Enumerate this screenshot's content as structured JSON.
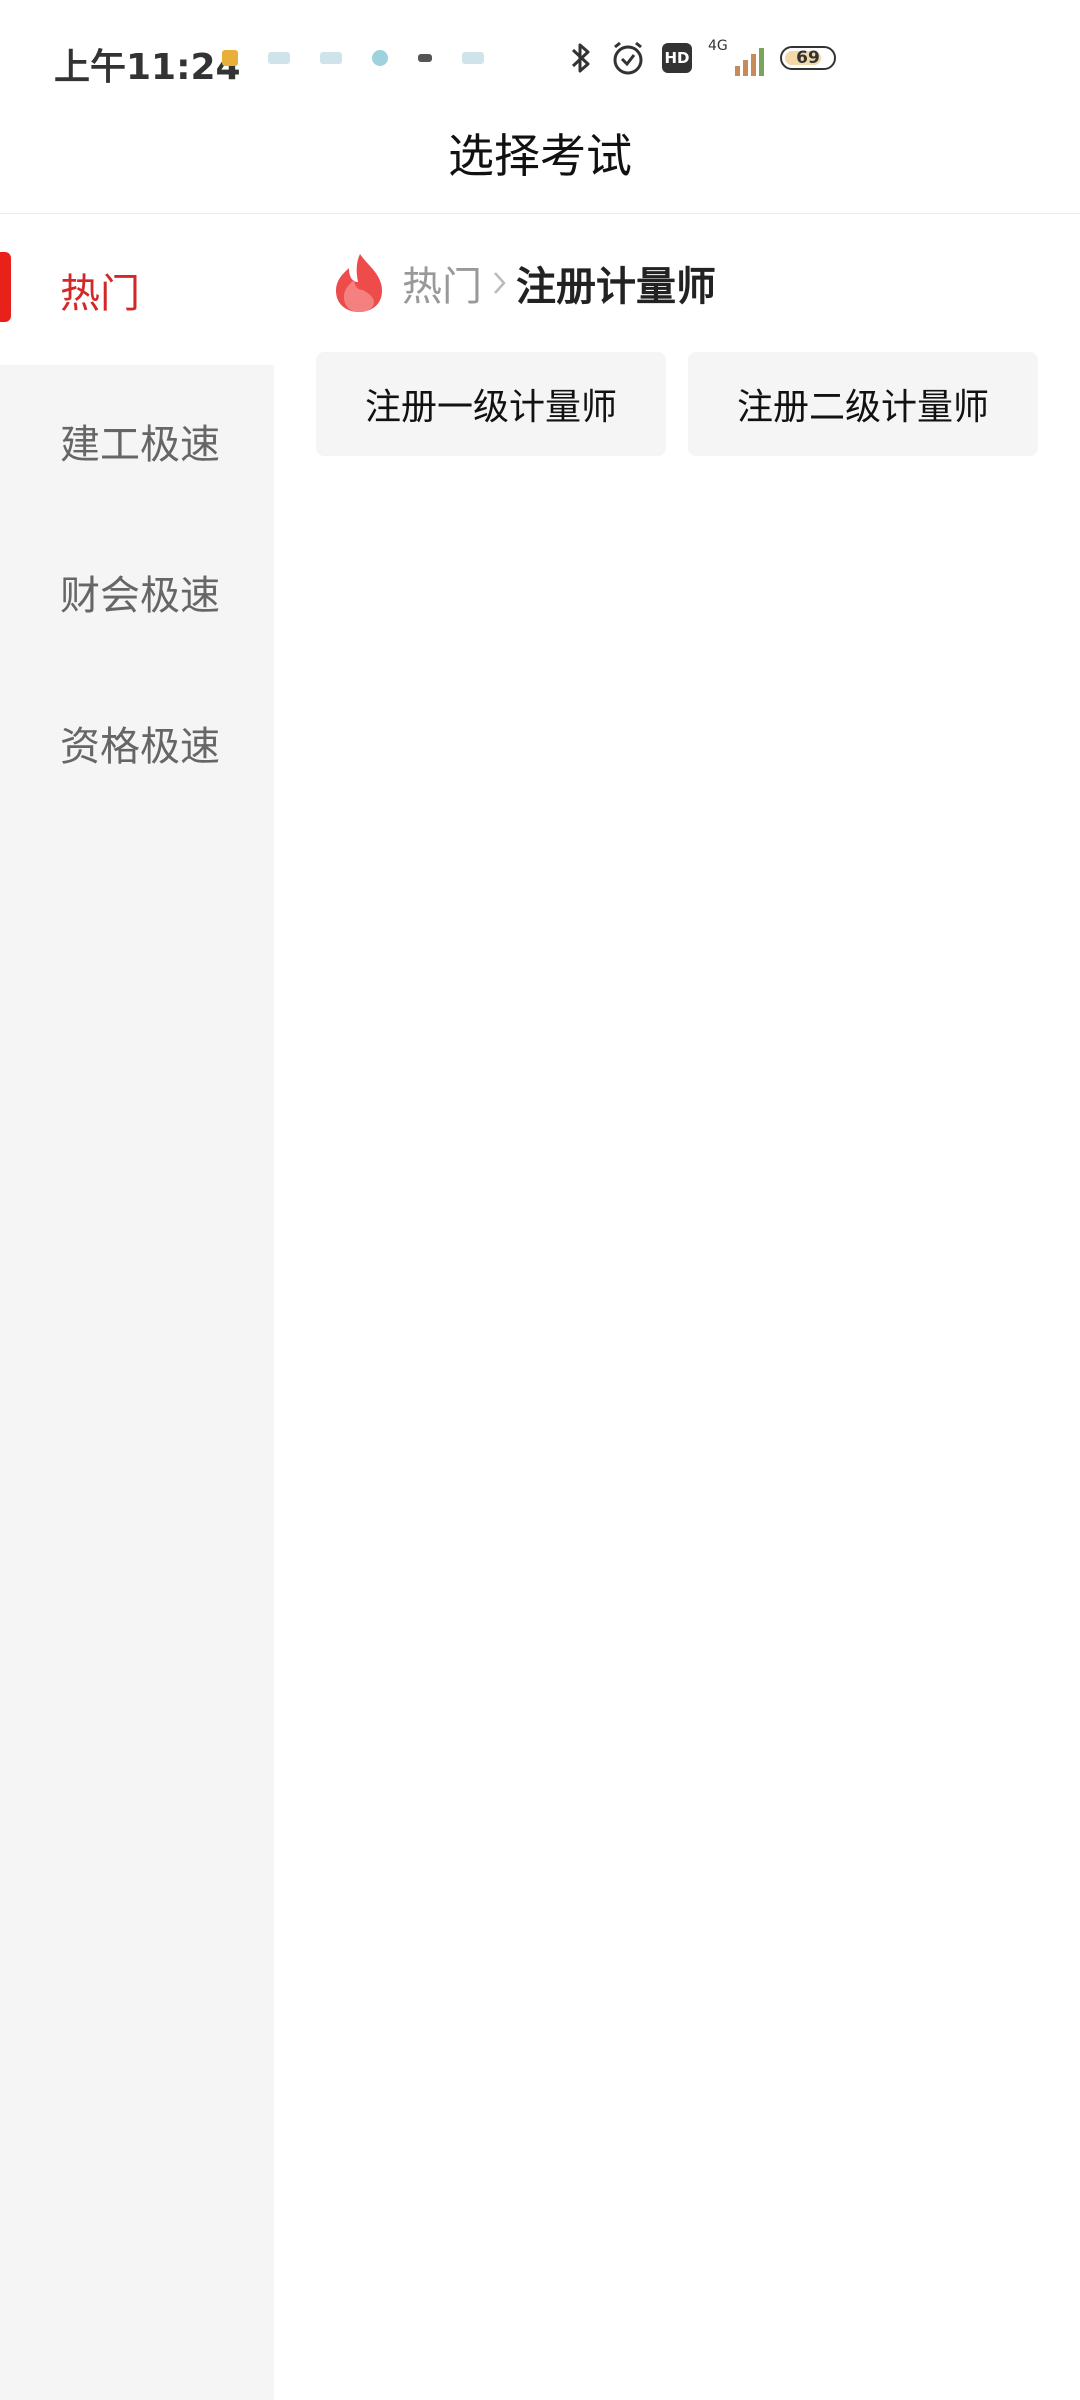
{
  "status_bar": {
    "time": "上午11:24",
    "network": "4G",
    "battery": "69",
    "icons": [
      "bluetooth-icon",
      "alarm-icon",
      "hd-icon",
      "signal-icon",
      "battery-icon"
    ]
  },
  "header": {
    "title": "选择考试"
  },
  "sidebar": {
    "items": [
      {
        "label": "热门",
        "active": true
      },
      {
        "label": "建工极速",
        "active": false
      },
      {
        "label": "财会极速",
        "active": false
      },
      {
        "label": "资格极速",
        "active": false
      }
    ]
  },
  "main": {
    "breadcrumb": {
      "parent": "热门",
      "current": "注册计量师"
    },
    "exams": [
      {
        "label": "注册一级计量师"
      },
      {
        "label": "注册二级计量师"
      }
    ]
  },
  "colors": {
    "accent": "#e8221b",
    "active_text": "#d22828",
    "sidebar_bg": "#f5f5f5",
    "button_bg": "#f5f5f5"
  }
}
